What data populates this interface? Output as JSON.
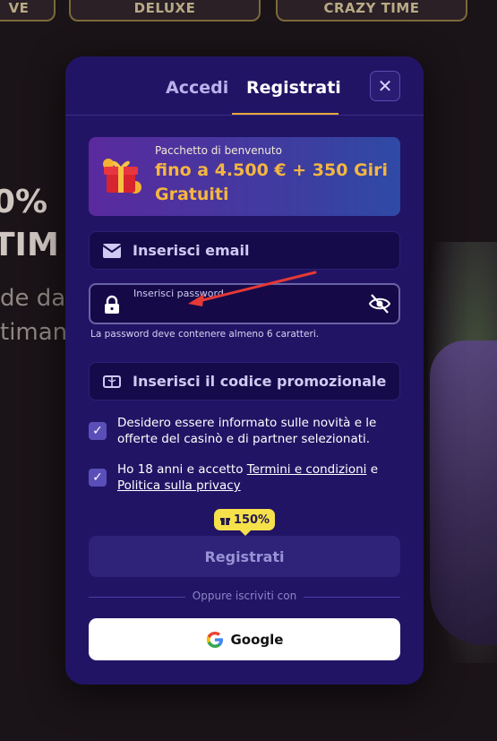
{
  "background": {
    "tiles": [
      "VE",
      "DELUXE",
      "CRAZY TIME"
    ],
    "big_text_1": "0%",
    "big_text_2": "TIM",
    "side_text_1": "de dal",
    "side_text_2": "timana"
  },
  "modal": {
    "tabs": {
      "login": "Accedi",
      "register": "Registrati"
    },
    "close_label": "✕",
    "promo": {
      "small": "Pacchetto di benvenuto",
      "big": "fino a 4.500 € + 350 Giri Gratuiti"
    },
    "email": {
      "placeholder": "Inserisci email"
    },
    "password": {
      "label": "Inserisci password",
      "hint": "La password deve contenere almeno 6 caratteri."
    },
    "promo_code": {
      "placeholder": "Inserisci il codice promozionale"
    },
    "news_consent": "Desidero essere informato sulle novità e le offerte del casinò e di partner selezionati.",
    "age_consent": {
      "prefix": "Ho 18 anni e accetto ",
      "terms_link": "Termini e condizioni",
      "middle": " e",
      "privacy_link": "Politica sulla privacy"
    },
    "bonus_badge": "150%",
    "register_button": "Registrati",
    "divider_text": "Oppure iscriviti con",
    "google_button": "Google"
  },
  "colors": {
    "modal_bg": "#221465",
    "accent_underline": "#e7a93b",
    "promo_highlight": "#f5b640",
    "badge": "#f6e14a",
    "annotation_arrow": "#e53935"
  }
}
